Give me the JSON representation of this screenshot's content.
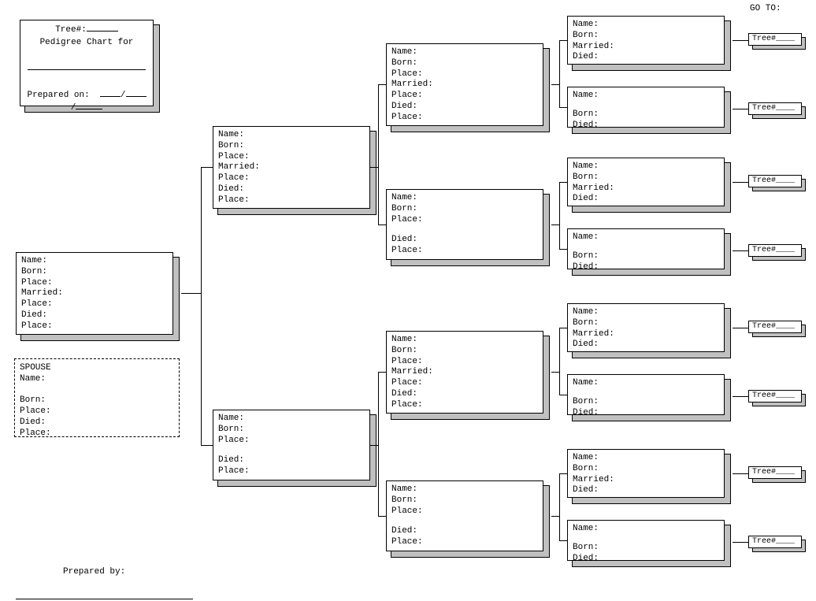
{
  "goto_label": "GO TO:",
  "header": {
    "tree_label": "Tree#:",
    "pedigree_label": "Pedigree Chart for",
    "prepared_on_label": "Prepared on:",
    "date_sep": "/"
  },
  "fields": {
    "name": "Name:",
    "born": "Born:",
    "place": "Place:",
    "married": "Married:",
    "died": "Died:",
    "spouse": "SPOUSE"
  },
  "tree_tag": "Tree#____",
  "prepared_by": "Prepared by:"
}
